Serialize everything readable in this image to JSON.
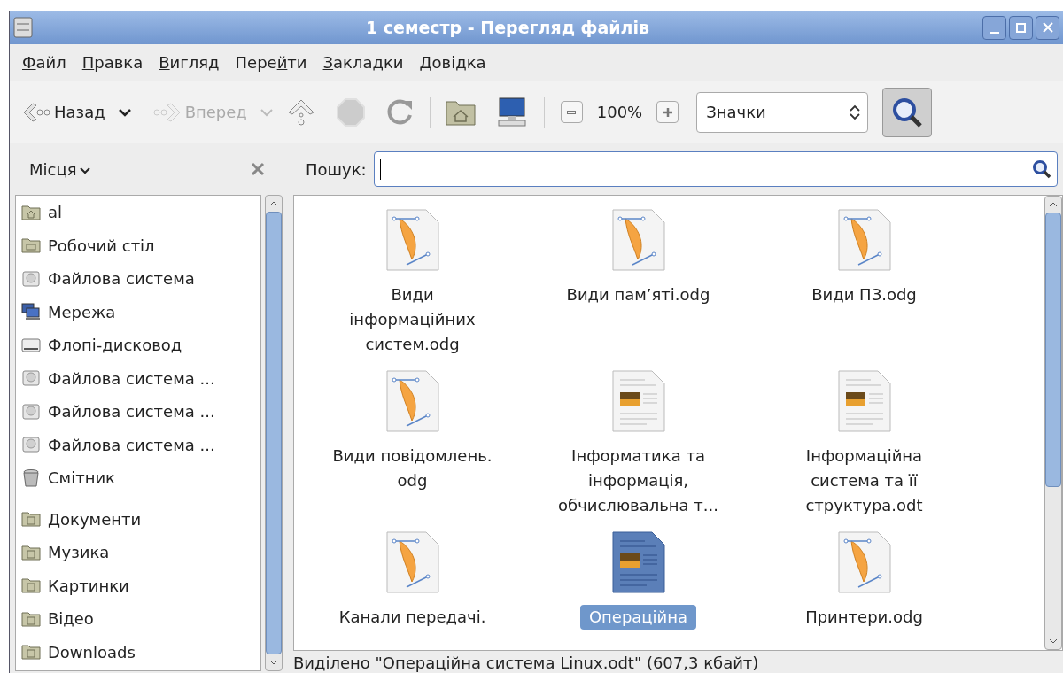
{
  "window": {
    "title": "1 семестр - Перегляд файлів"
  },
  "menu": [
    {
      "key": "Ф",
      "post": "айл"
    },
    {
      "key": "П",
      "post": "равка"
    },
    {
      "key": "В",
      "post": "игляд"
    },
    {
      "pre": "Пере",
      "key": "й",
      "post": "ти"
    },
    {
      "key": "З",
      "post": "акладки"
    },
    {
      "key": "Д",
      "post": "овідка"
    }
  ],
  "toolbar": {
    "back": {
      "label": "Назад",
      "disabled": false
    },
    "forward": {
      "label": "Вперед",
      "disabled": true
    },
    "stop": {
      "disabled": true
    },
    "zoom": "100%",
    "view": "Значки",
    "search_toggle": {
      "selected": true
    }
  },
  "sidebar": {
    "title": "Місця",
    "places": [
      {
        "label": "al",
        "kind": "home"
      },
      {
        "label": "Робочий стіл",
        "kind": "desktop"
      },
      {
        "label": "Файлова система",
        "kind": "drive"
      },
      {
        "label": "Мережа",
        "kind": "network"
      },
      {
        "label": "Флопі-дисковод",
        "kind": "floppy"
      },
      {
        "label": "Файлова система ...",
        "kind": "drive"
      },
      {
        "label": "Файлова система ...",
        "kind": "drive"
      },
      {
        "label": "Файлова система ...",
        "kind": "drive"
      },
      {
        "label": "Смітник",
        "kind": "trash"
      }
    ],
    "bookmarks": [
      {
        "label": "Документи",
        "kind": "folder"
      },
      {
        "label": "Музика",
        "kind": "folder"
      },
      {
        "label": "Картинки",
        "kind": "folder"
      },
      {
        "label": "Відео",
        "kind": "folder"
      },
      {
        "label": "Downloads",
        "kind": "folder"
      }
    ]
  },
  "search": {
    "label": "Пошук:"
  },
  "files": [
    {
      "name": "Види інформаційних систем.odg",
      "kind": "drawing",
      "selected": false
    },
    {
      "name": "Види пам’яті.odg",
      "kind": "drawing",
      "selected": false
    },
    {
      "name": "Види ПЗ.odg",
      "kind": "drawing",
      "selected": false
    },
    {
      "name": "Види повідомлень. odg",
      "kind": "drawing",
      "selected": false
    },
    {
      "name": "Інформатика та інформація, обчислювальна т...",
      "kind": "document",
      "selected": false
    },
    {
      "name": "Інформаційна система та її структура.odt",
      "kind": "document",
      "selected": false
    },
    {
      "name": "Канали передачі.",
      "kind": "drawing",
      "selected": false
    },
    {
      "name": "Операційна",
      "kind": "document",
      "selected": true
    },
    {
      "name": "Принтери.odg",
      "kind": "drawing",
      "selected": false
    }
  ],
  "status_bar": "Виділено \"Операційна система Linux.odt\" (607,3 кбайт)"
}
